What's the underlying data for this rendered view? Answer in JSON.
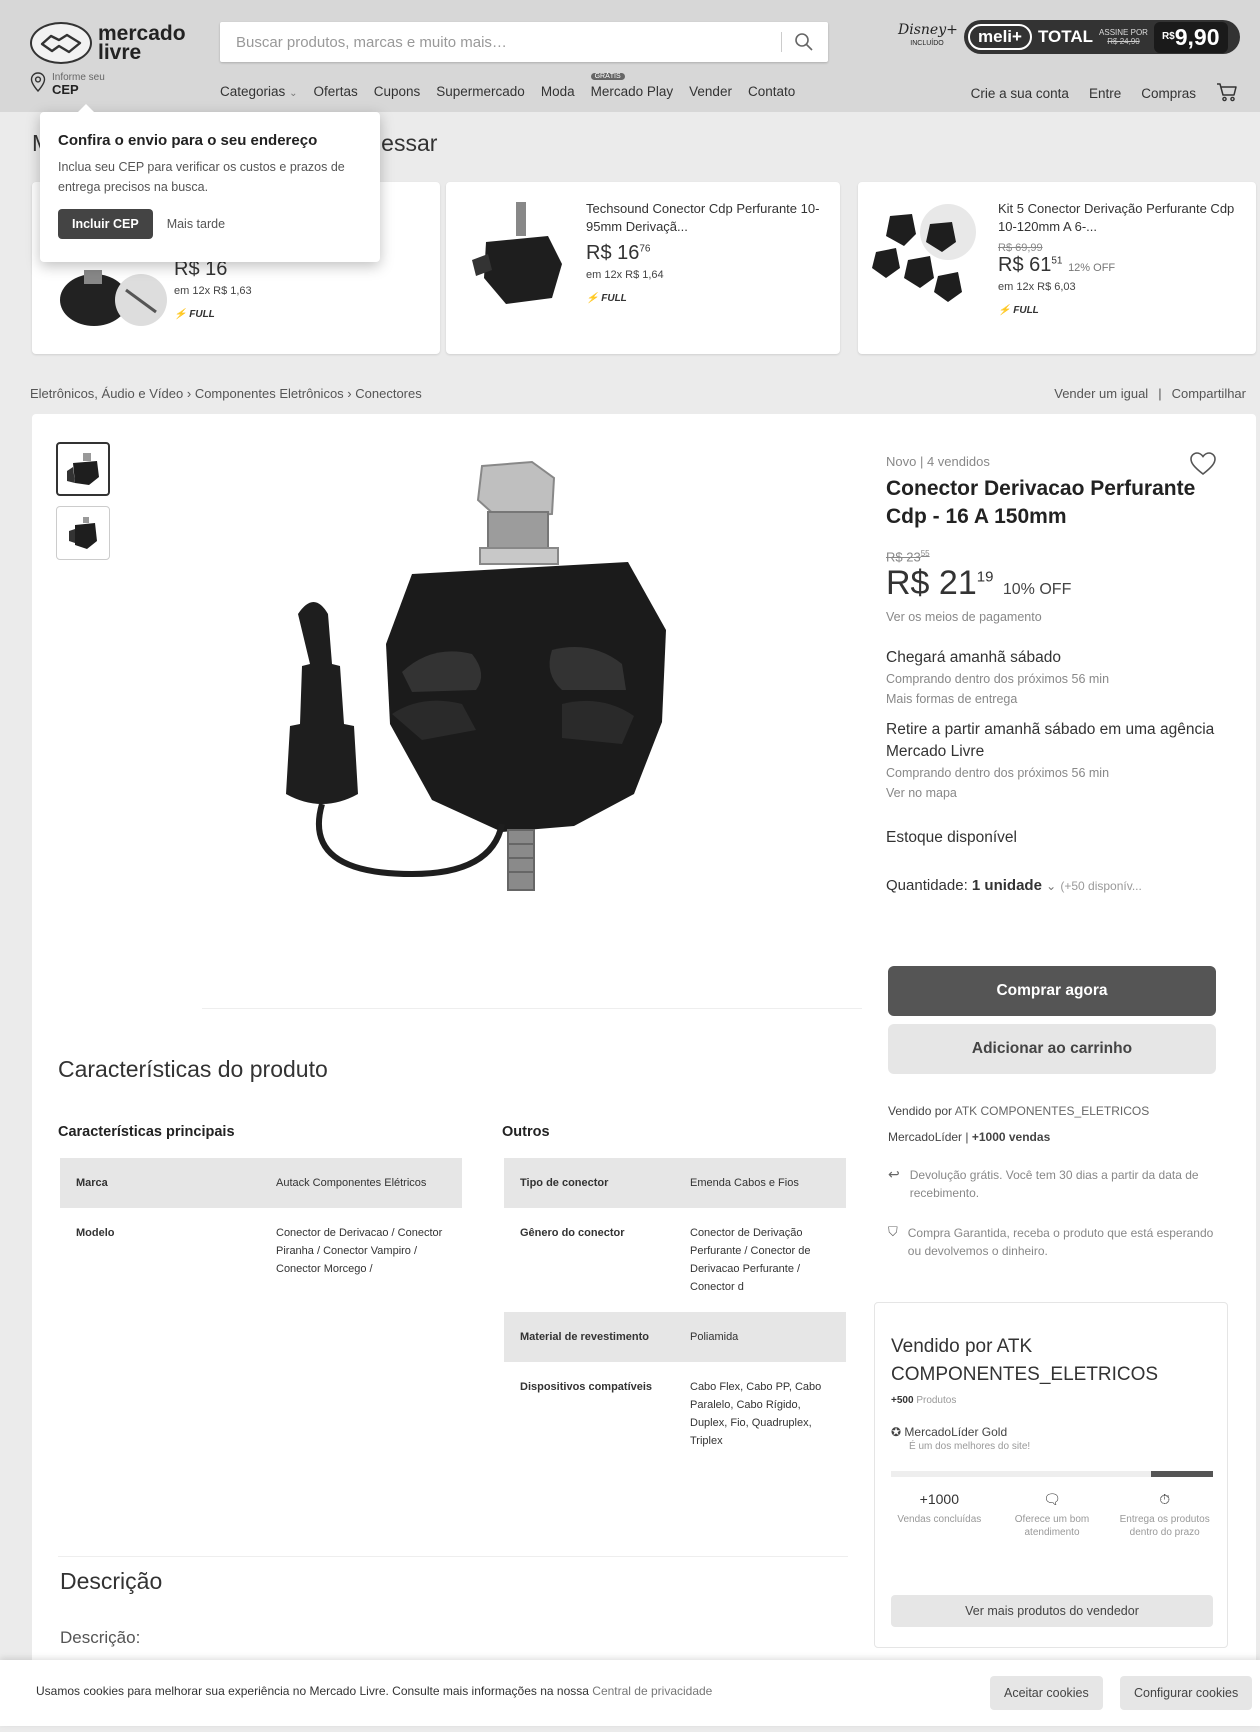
{
  "header": {
    "logo_text_1": "mercado",
    "logo_text_2": "livre",
    "search_placeholder": "Buscar produtos, marcas e muito mais…",
    "disney_name": "Disney+",
    "disney_included": "INCLUÍDO",
    "meli_label": "meli+",
    "meli_total": "TOTAL",
    "meli_sub_1": "ASSINE POR",
    "meli_sub_old": "R$ 24,90",
    "meli_price_currency": "R$",
    "meli_price": "9,90",
    "cep_line1": "Informe seu",
    "cep_line2": "CEP",
    "nav": [
      "Categorias",
      "Ofertas",
      "Cupons",
      "Supermercado",
      "Moda",
      "Mercado Play",
      "Vender",
      "Contato"
    ],
    "nav_badge": "GRÁTIS",
    "nav_right": [
      "Crie a sua conta",
      "Entre",
      "Compras"
    ]
  },
  "popup": {
    "title": "Confira o envio para o seu endereço",
    "text": "Inclua seu CEP para verificar os custos e prazos de entrega precisos na busca.",
    "primary": "Incluir CEP",
    "secondary": "Mais tarde"
  },
  "history": {
    "title_start": "M",
    "title_end": "essar"
  },
  "cards": [
    {
      "title": "",
      "price_int": "R$ 16",
      "price_cents": "",
      "installments": "em 12x R$ 1,63",
      "full": "FULL"
    },
    {
      "title": "Techsound Conector Cdp Perfurante 10-95mm Derivaçã...",
      "price_int": "R$ 16",
      "price_cents": "76",
      "installments": "em 12x R$ 1,64",
      "full": "FULL"
    },
    {
      "title": "Kit 5 Conector Derivação Perfurante Cdp 10-120mm A 6-...",
      "old_price": "R$ 69,99",
      "price_int": "R$ 61",
      "price_cents": "51",
      "discount": "12% OFF",
      "installments": "em 12x R$ 6,03",
      "full": "FULL"
    }
  ],
  "breadcrumb": [
    "Eletrônicos, Áudio e Vídeo",
    "Componentes Eletrônicos",
    "Conectores"
  ],
  "breadcrumb_sep": "›",
  "breadcrumb_right": [
    "Vender um igual",
    "Compartilhar"
  ],
  "product": {
    "condition": "Novo | 4 vendidos",
    "title": "Conector Derivacao Perfurante Cdp - 16 A 150mm",
    "old_price": "R$ 23",
    "old_price_cents": "55",
    "price_int": "R$ 21",
    "price_cents": "19",
    "discount": "10% OFF",
    "payment_link": "Ver os meios de pagamento",
    "delivery_title": "Chegará amanhã sábado",
    "delivery_sub": "Comprando dentro dos próximos 56 min",
    "delivery_link": "Mais formas de entrega",
    "pickup_title": "Retire a partir amanhã sábado em uma agência Mercado Livre",
    "pickup_sub": "Comprando dentro dos próximos 56 min",
    "pickup_link": "Ver no mapa",
    "stock": "Estoque disponível",
    "qty_label": "Quantidade:",
    "qty_value": "1 unidade",
    "qty_avail": "(+50 disponív...",
    "buy_now": "Comprar agora",
    "add_cart": "Adicionar ao carrinho",
    "sold_by_prefix": "Vendido por",
    "sold_by": "ATK COMPONENTES_ELETRICOS",
    "leader": "MercadoLíder",
    "sales": "+1000 vendas",
    "return_text": "Devolução grátis. Você tem 30 dias a partir da data de recebimento.",
    "guarantee_text": "Compra Garantida, receba o produto que está esperando ou devolvemos o dinheiro."
  },
  "specs": {
    "title": "Características do produto",
    "main_title": "Características principais",
    "main": [
      {
        "k": "Marca",
        "v": "Autack Componentes Elétricos"
      },
      {
        "k": "Modelo",
        "v": "Conector de Derivacao / Conector Piranha / Conector Vampiro / Conector Morcego /"
      }
    ],
    "other_title": "Outros",
    "other": [
      {
        "k": "Tipo de conector",
        "v": "Emenda Cabos e Fios"
      },
      {
        "k": "Gênero do conector",
        "v": "Conector de Derivação Perfurante / Conector de Derivacao Perfurante / Conector d"
      },
      {
        "k": "Material de revestimento",
        "v": "Poliamida"
      },
      {
        "k": "Dispositivos compatíveis",
        "v": "Cabo Flex, Cabo PP, Cabo Paralelo, Cabo Rígido, Duplex, Fio, Quadruplex, Triplex"
      }
    ]
  },
  "seller": {
    "title": "Vendido por ATK COMPONENTES_ELETRICOS",
    "products": "+500",
    "products_label": "Produtos",
    "level": "MercadoLíder Gold",
    "level_sub": "É um dos melhores do site!",
    "stats": [
      {
        "value": "+1000",
        "label": "Vendas concluídas"
      },
      {
        "value": "",
        "label": "Oferece um bom atendimento"
      },
      {
        "value": "",
        "label": "Entrega os produtos dentro do prazo"
      }
    ],
    "more_button": "Ver mais produtos do vendedor"
  },
  "description": {
    "title": "Descrição",
    "subtitle": "Descrição:"
  },
  "cookie": {
    "text": "Usamos cookies para melhorar sua experiência no Mercado Livre. Consulte mais informações na nossa",
    "link": "Central de privacidade",
    "accept": "Aceitar cookies",
    "configure": "Configurar cookies"
  }
}
